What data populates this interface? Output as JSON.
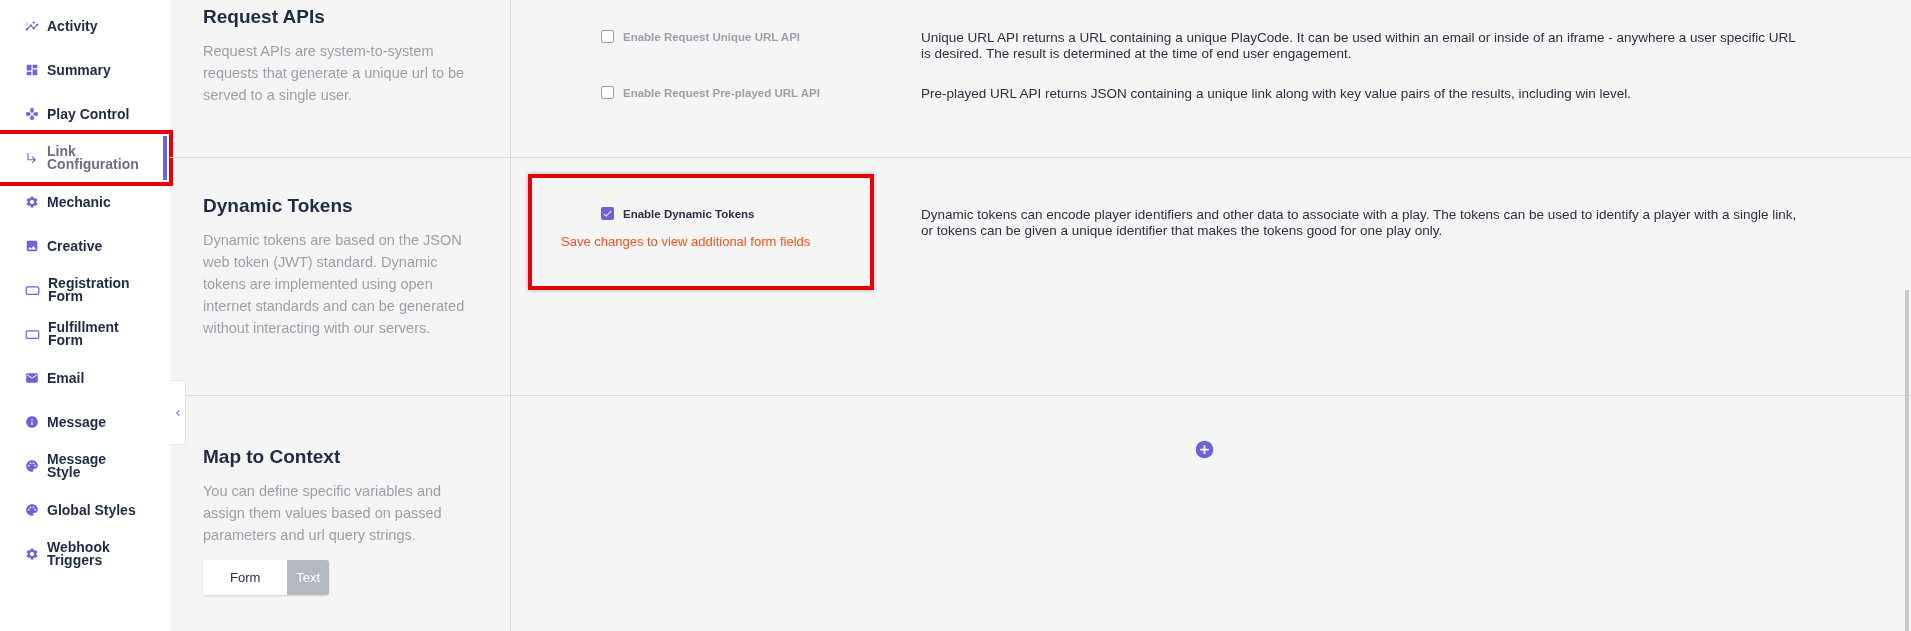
{
  "sidebar": {
    "items": [
      {
        "label": "Activity",
        "selected": false,
        "highlighted": false
      },
      {
        "label": "Summary",
        "selected": false,
        "highlighted": false
      },
      {
        "label": "Play Control",
        "selected": false,
        "highlighted": false
      },
      {
        "label": "Link Configuration",
        "selected": true,
        "highlighted": true
      },
      {
        "label": "Mechanic",
        "selected": false,
        "highlighted": false
      },
      {
        "label": "Creative",
        "selected": false,
        "highlighted": false
      },
      {
        "label": "Registration Form",
        "selected": false,
        "highlighted": false
      },
      {
        "label": "Fulfillment Form",
        "selected": false,
        "highlighted": false
      },
      {
        "label": "Email",
        "selected": false,
        "highlighted": false
      },
      {
        "label": "Message",
        "selected": false,
        "highlighted": false
      },
      {
        "label": "Message Style",
        "selected": false,
        "highlighted": false
      },
      {
        "label": "Global Styles",
        "selected": false,
        "highlighted": false
      },
      {
        "label": "Webhook Triggers",
        "selected": false,
        "highlighted": false
      }
    ]
  },
  "sections": [
    {
      "title": "Request APIs",
      "description": "Request APIs are system-to-system requests that generate a unique url to be served to a single user.",
      "kind": "options",
      "options": [
        {
          "label": "Enable Request Unique URL API",
          "checked": false,
          "highlighted": false,
          "description": "Unique URL API returns a URL containing a unique PlayCode. It can be used within an email or inside of an iframe - anywhere a user specific URL is desired. The result is determined at the time of end user engagement."
        },
        {
          "label": "Enable Request Pre-played URL API",
          "checked": false,
          "highlighted": false,
          "description": "Pre-played URL API returns JSON containing a unique link along with key value pairs of the results, including win level."
        }
      ]
    },
    {
      "title": "Dynamic Tokens",
      "description": "Dynamic tokens are based on the JSON web token (JWT) standard. Dynamic tokens are implemented using open internet standards and can be generated without interacting with our servers.",
      "kind": "options",
      "options": [
        {
          "label": "Enable Dynamic Tokens",
          "checked": true,
          "highlighted": true,
          "warning": "Save changes to view additional form fields",
          "description": "Dynamic tokens can encode player identifiers and other data to associate with a play. The tokens can be used to identify a player with a single link, or tokens can be given a unique identifier that makes the tokens good for one play only."
        }
      ]
    },
    {
      "title": "Map to Context",
      "description": "You can define specific variables and assign them values based on passed parameters and url query strings.",
      "kind": "mapping",
      "toggle": [
        {
          "label": "Form",
          "selected": true
        },
        {
          "label": "Text",
          "selected": false
        }
      ]
    }
  ]
}
